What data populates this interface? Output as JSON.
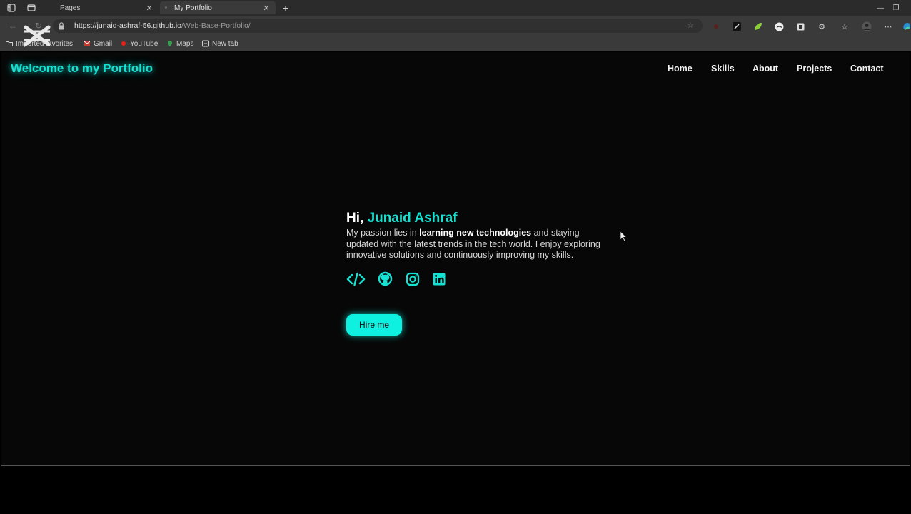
{
  "browser": {
    "tabs": [
      {
        "label": "Pages",
        "active": false
      },
      {
        "label": "My Portfolio",
        "active": true
      }
    ],
    "url_host": "https://junaid-ashraf-56.github.io",
    "url_path": "/Web-Base-Portfolio/",
    "bookmarks": [
      {
        "label": "Imported favorites",
        "icon": "folder-icon"
      },
      {
        "label": "Gmail",
        "icon": "gmail-icon"
      },
      {
        "label": "YouTube",
        "icon": "youtube-icon"
      },
      {
        "label": "Maps",
        "icon": "maps-icon"
      },
      {
        "label": "New tab",
        "icon": "new-tab-icon"
      }
    ]
  },
  "site": {
    "brand": "Welcome to my Portfolio",
    "nav": [
      "Home",
      "Skills",
      "About",
      "Projects",
      "Contact"
    ],
    "hero": {
      "greeting": "Hi,",
      "name": "Junaid Ashraf",
      "bio_pre": "My passion lies in",
      "bio_bold": "learning new technologies",
      "bio_post": "and staying updated with the latest trends in the tech world. I enjoy exploring innovative solutions and continuously improving my skills.",
      "social_icons": [
        "code-icon",
        "github-icon",
        "instagram-icon",
        "linkedin-icon"
      ],
      "cta": "Hire me"
    }
  },
  "colors": {
    "accent": "#14e3d3",
    "button": "#0ef0e0",
    "page_bg": "#070707"
  }
}
